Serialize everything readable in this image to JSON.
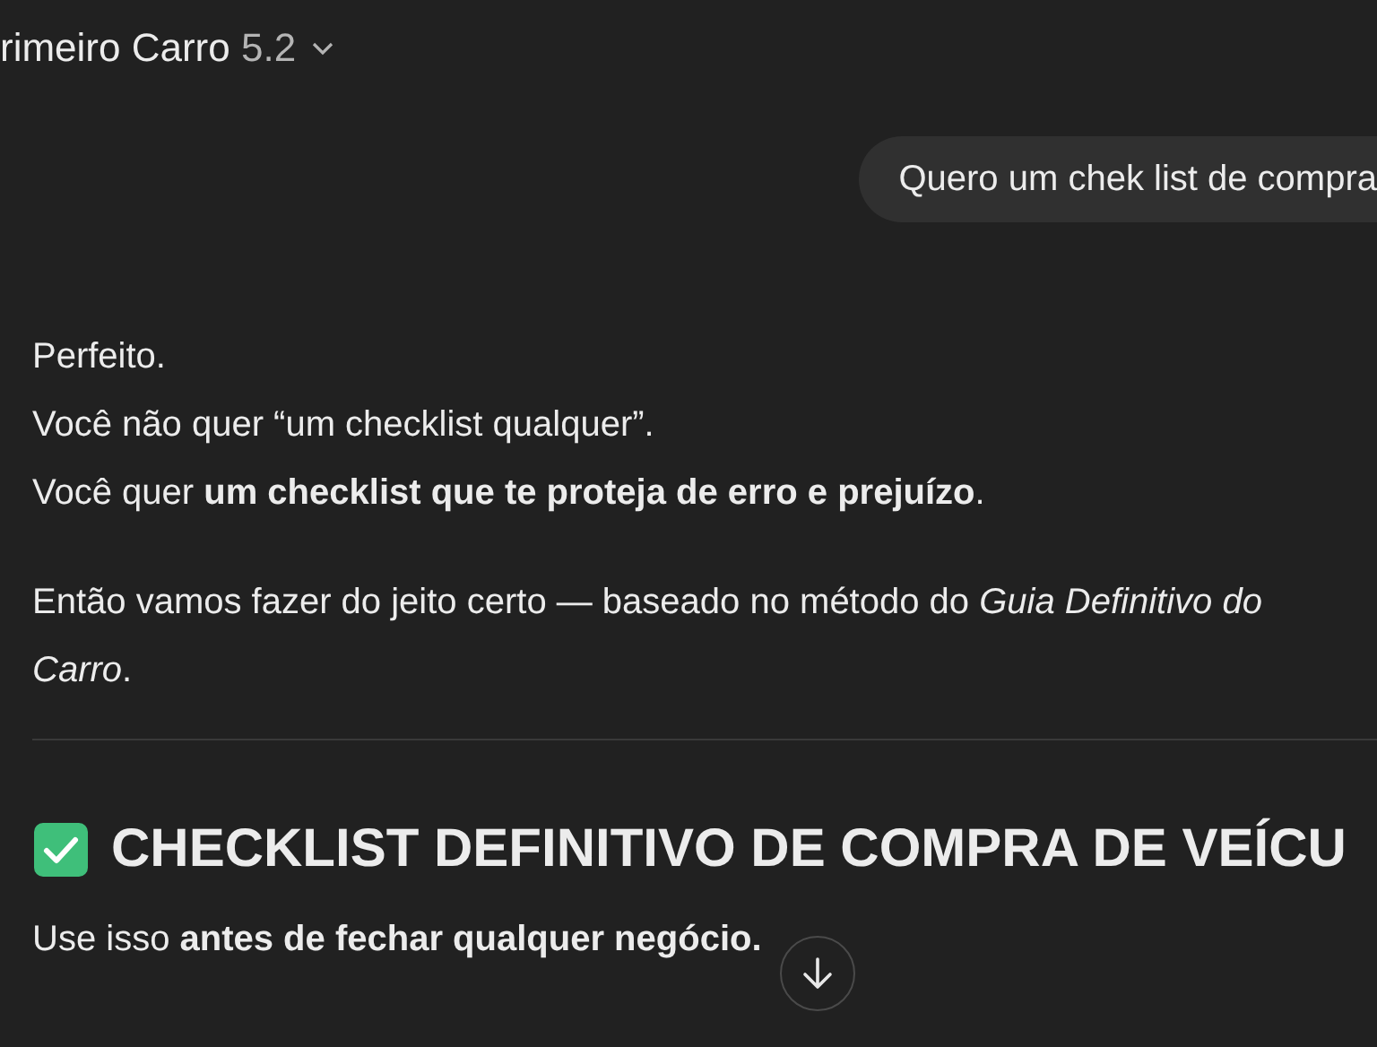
{
  "header": {
    "title": "rimeiro Carro",
    "version": "5.2"
  },
  "user_message": "Quero um chek list de compra",
  "reply": {
    "paragraphs": [
      {
        "lines": [
          "Perfeito.",
          "Você não quer “um checklist qualquer”.",
          "Você quer **um checklist que te proteja de erro e prejuízo**."
        ]
      },
      {
        "lines": [
          "Então vamos fazer do jeito certo — baseado no método do *Guia Definitivo do*",
          "*Carro*."
        ]
      }
    ],
    "heading": "CHECKLIST DEFINITIVO DE COMPRA DE VEÍCU",
    "intro": "Use isso **antes de fechar qualquer negócio.**"
  }
}
